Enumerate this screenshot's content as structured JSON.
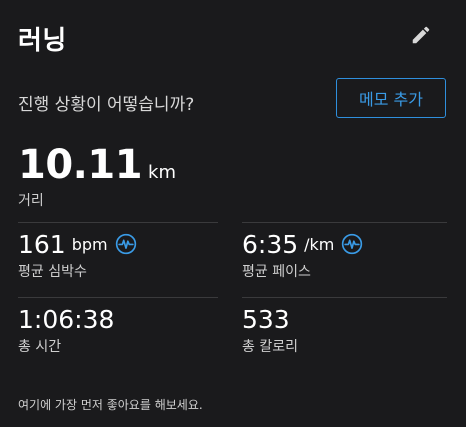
{
  "header": {
    "title": "러닝"
  },
  "prompt": {
    "text": "진행 상황이 어떻습니까?",
    "memo_button_label": "메모 추가"
  },
  "distance": {
    "value": "10.11",
    "unit": "km",
    "label": "거리"
  },
  "stats": {
    "heart_rate": {
      "value": "161",
      "unit": "bpm",
      "label": "평균 심박수",
      "icon": "pulse-icon"
    },
    "pace": {
      "value": "6:35",
      "unit": "/km",
      "label": "평균 페이스",
      "icon": "pulse-icon"
    },
    "total_time": {
      "value": "1:06:38",
      "label": "총 시간"
    },
    "calories": {
      "value": "533",
      "label": "총 칼로리"
    }
  },
  "footer": {
    "text": "여기에 가장 먼저 좋아요를 해보세요."
  },
  "colors": {
    "background": "#1a1a1c",
    "accent": "#2f8fdc",
    "divider": "#3a3a3c"
  }
}
